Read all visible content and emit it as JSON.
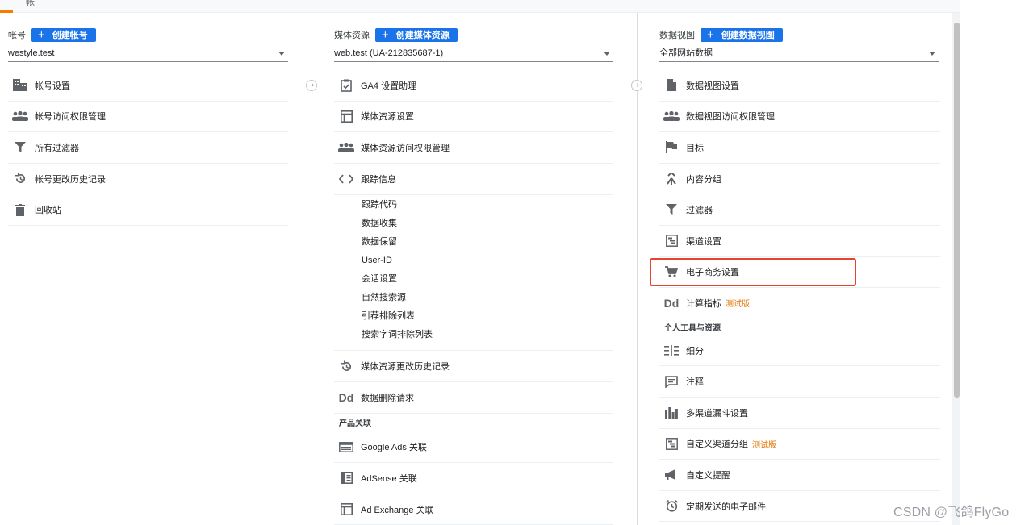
{
  "topbar": {
    "tab_label": "帐"
  },
  "account": {
    "label": "帐号",
    "create_label": "创建帐号",
    "selected": "westyle.test",
    "items": [
      "帐号设置",
      "帐号访问权限管理",
      "所有过滤器",
      "帐号更改历史记录",
      "回收站"
    ]
  },
  "property": {
    "label": "媒体资源",
    "create_label": "创建媒体资源",
    "selected": "web.test (UA-212835687-1)",
    "items": [
      "GA4 设置助理",
      "媒体资源设置",
      "媒体资源访问权限管理",
      "跟踪信息"
    ],
    "tracking_sub": [
      "跟踪代码",
      "数据收集",
      "数据保留",
      "User-ID",
      "会话设置",
      "自然搜索源",
      "引荐排除列表",
      "搜索字词排除列表"
    ],
    "items_after": [
      "媒体资源更改历史记录",
      "数据删除请求"
    ],
    "section_product": "产品关联",
    "product_links": [
      "Google Ads 关联",
      "AdSense 关联",
      "Ad Exchange 关联"
    ]
  },
  "view": {
    "label": "数据视图",
    "create_label": "创建数据视图",
    "selected": "全部网站数据",
    "items": [
      "数据视图设置",
      "数据视图访问权限管理",
      "目标",
      "内容分组",
      "过滤器",
      "渠道设置",
      "电子商务设置",
      "计算指标"
    ],
    "beta_label": "测试版",
    "section_personal": "个人工具与资源",
    "personal": [
      "细分",
      "注释",
      "多渠道漏斗设置",
      "自定义渠道分组",
      "自定义提醒",
      "定期发送的电子邮件"
    ]
  },
  "icons": {
    "dd_glyph": "Dd"
  },
  "colors": {
    "accent": "#1a73e8",
    "highlight": "#e8432e",
    "beta": "#e37400"
  },
  "watermark": "CSDN @飞鸽FlyGo"
}
